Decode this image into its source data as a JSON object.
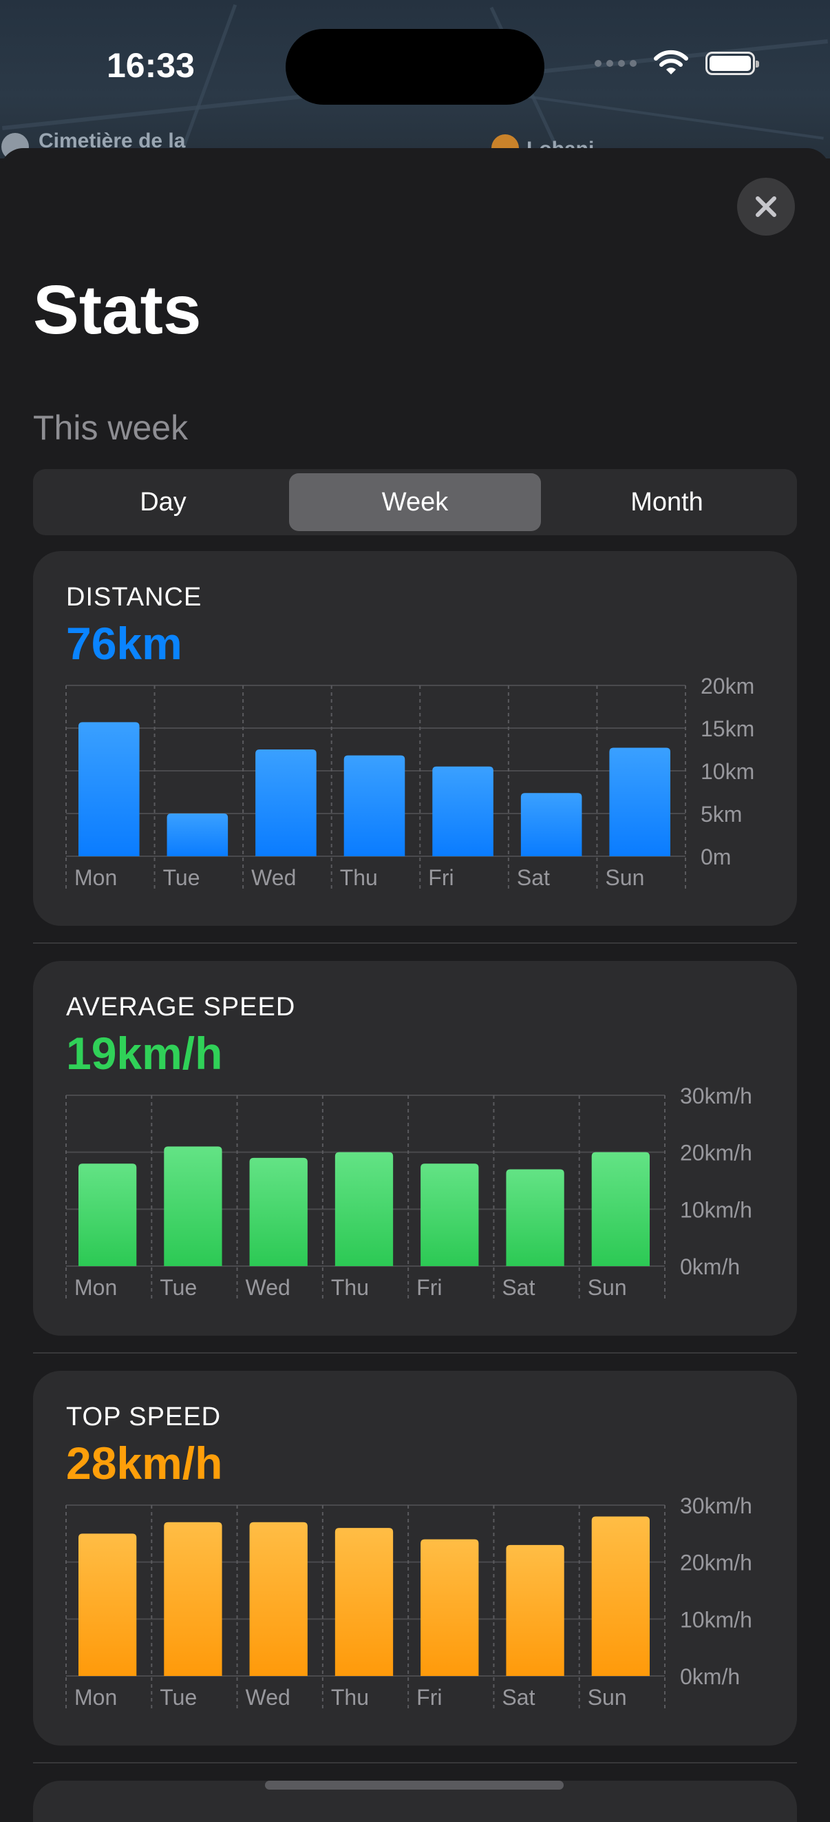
{
  "status_bar": {
    "time": "16:33"
  },
  "map": {
    "label_left": "Cimetière de la",
    "label_right": "Lobani"
  },
  "page": {
    "title": "Stats",
    "subtitle": "This week"
  },
  "segments": [
    {
      "label": "Day",
      "active": false
    },
    {
      "label": "Week",
      "active": true
    },
    {
      "label": "Month",
      "active": false
    }
  ],
  "cards": [
    {
      "label": "DISTANCE",
      "value": "76km",
      "color": "#0a84ff"
    },
    {
      "label": "AVERAGE SPEED",
      "value": "19km/h",
      "color": "#30d158"
    },
    {
      "label": "TOP SPEED",
      "value": "28km/h",
      "color": "#ff9f0a"
    }
  ],
  "chart_data": [
    {
      "type": "bar",
      "categories": [
        "Mon",
        "Tue",
        "Wed",
        "Thu",
        "Fri",
        "Sat",
        "Sun"
      ],
      "values": [
        15.7,
        5.0,
        12.5,
        11.8,
        10.5,
        7.4,
        12.7
      ],
      "unit": "km",
      "ylim": [
        0,
        20
      ],
      "yticks": [
        "0m",
        "5km",
        "10km",
        "15km",
        "20km"
      ],
      "colors": {
        "top": "#3aa0ff",
        "bottom": "#0a7cff"
      }
    },
    {
      "type": "bar",
      "categories": [
        "Mon",
        "Tue",
        "Wed",
        "Thu",
        "Fri",
        "Sat",
        "Sun"
      ],
      "values": [
        18,
        21,
        19,
        20,
        18,
        17,
        20
      ],
      "unit": "km/h",
      "ylim": [
        0,
        30
      ],
      "yticks": [
        "0km/h",
        "10km/h",
        "20km/h",
        "30km/h"
      ],
      "colors": {
        "top": "#63e385",
        "bottom": "#2cc954"
      }
    },
    {
      "type": "bar",
      "categories": [
        "Mon",
        "Tue",
        "Wed",
        "Thu",
        "Fri",
        "Sat",
        "Sun"
      ],
      "values": [
        25,
        27,
        27,
        26,
        24,
        23,
        28
      ],
      "unit": "km/h",
      "ylim": [
        0,
        30
      ],
      "yticks": [
        "0km/h",
        "10km/h",
        "20km/h",
        "30km/h"
      ],
      "colors": {
        "top": "#ffbd45",
        "bottom": "#ff9a0a"
      }
    }
  ]
}
